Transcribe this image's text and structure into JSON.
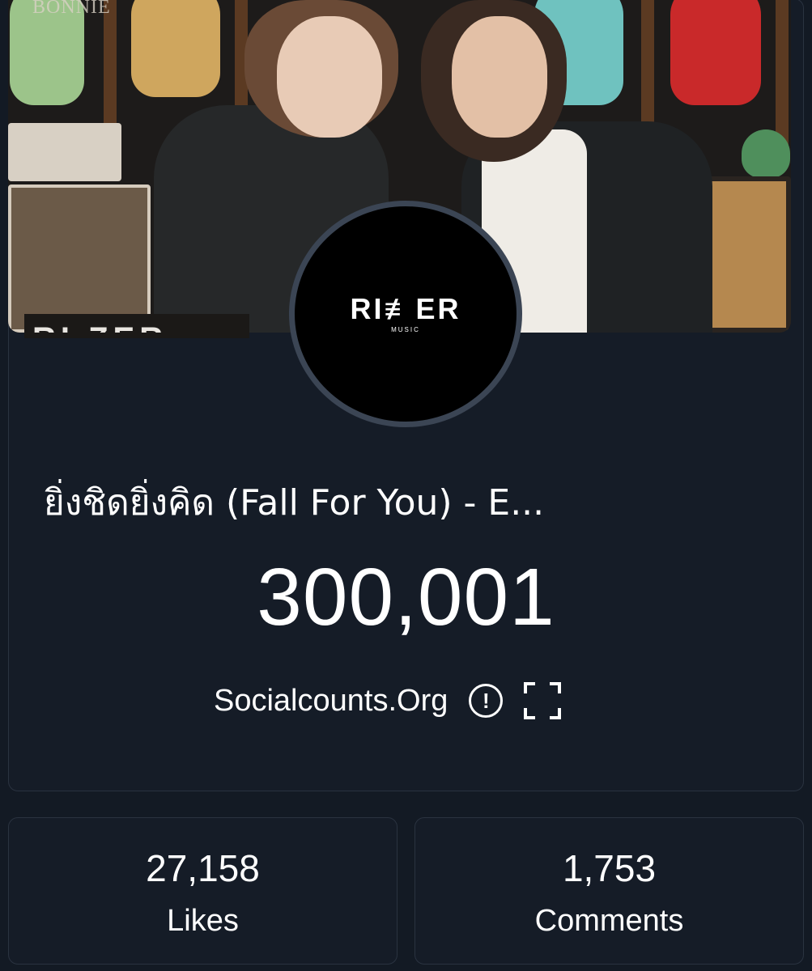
{
  "banner": {
    "watermark": "BONNIE",
    "partial_text": "RI ZER"
  },
  "channel": {
    "logo_word": "RI≢ER",
    "logo_sub": "MUSIC"
  },
  "video": {
    "title": "ยิ่งชิดยิ่งคิด (Fall For You) - E...",
    "count": "300,001"
  },
  "source": {
    "label": "Socialcounts.Org",
    "info_glyph": "!"
  },
  "stats": [
    {
      "value": "27,158",
      "label": "Likes"
    },
    {
      "value": "1,753",
      "label": "Comments"
    }
  ],
  "colors": {
    "background": "#131a24",
    "card": "#151c27",
    "border": "#2a3340",
    "avatar_ring": "#3b4554"
  }
}
